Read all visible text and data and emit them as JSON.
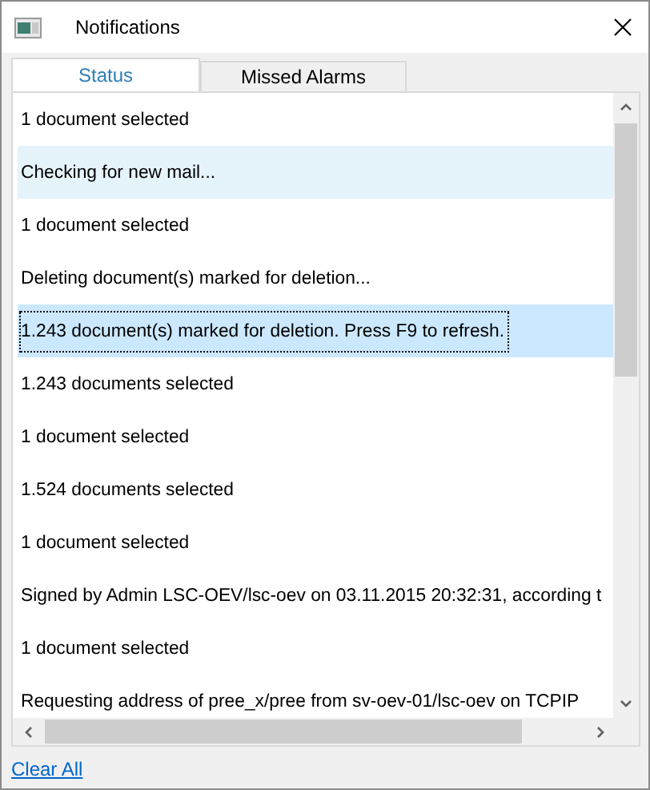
{
  "window": {
    "title": "Notifications"
  },
  "tabs": [
    {
      "label": "Status",
      "selected": true
    },
    {
      "label": "Missed Alarms",
      "selected": false
    }
  ],
  "messages": [
    {
      "text": "1 document selected",
      "selected": false,
      "hovered": false
    },
    {
      "text": "Checking for new mail...",
      "selected": false,
      "hovered": true
    },
    {
      "text": "1 document selected",
      "selected": false,
      "hovered": false
    },
    {
      "text": "Deleting document(s) marked for deletion...",
      "selected": false,
      "hovered": false
    },
    {
      "text": "1.243 document(s) marked for deletion.  Press F9 to refresh.",
      "selected": true,
      "hovered": false
    },
    {
      "text": "1.243 documents selected",
      "selected": false,
      "hovered": false
    },
    {
      "text": "1 document selected",
      "selected": false,
      "hovered": false
    },
    {
      "text": "1.524 documents selected",
      "selected": false,
      "hovered": false
    },
    {
      "text": "1 document selected",
      "selected": false,
      "hovered": false
    },
    {
      "text": "Signed by Admin LSC-OEV/lsc-oev on 03.11.2015 20:32:31, according t",
      "selected": false,
      "hovered": false
    },
    {
      "text": "1 document selected",
      "selected": false,
      "hovered": false
    },
    {
      "text": "Requesting address of pree_x/pree from sv-oev-01/lsc-oev on TCPIP",
      "selected": false,
      "hovered": false
    }
  ],
  "clear_link": "Clear All"
}
